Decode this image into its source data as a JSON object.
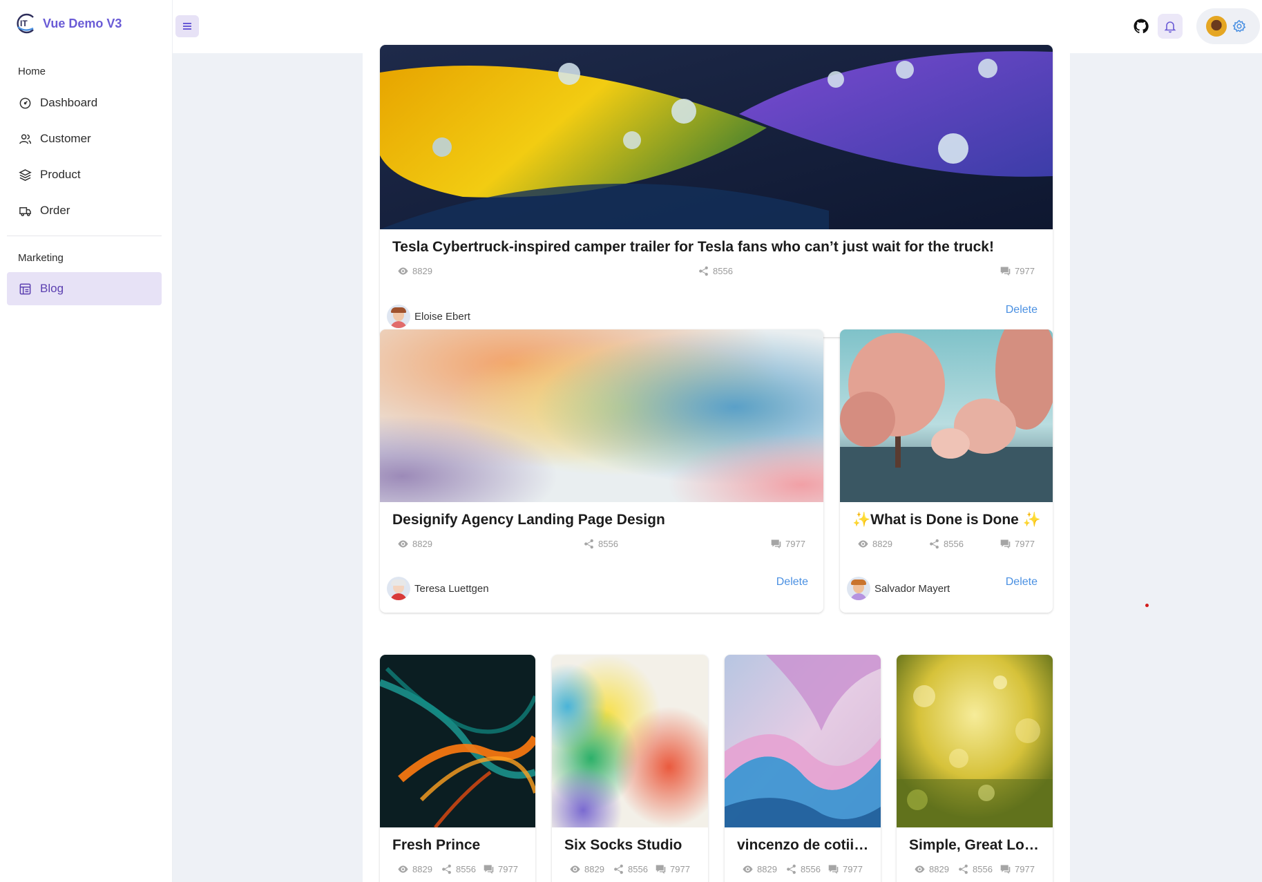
{
  "app": {
    "title": "Vue Demo V3",
    "accent": "#6a5bd6"
  },
  "sidebar": {
    "groups": [
      {
        "title": "Home",
        "items": [
          {
            "label": "Dashboard",
            "icon": "dashboard-gauge-icon"
          },
          {
            "label": "Customer",
            "icon": "users-icon"
          },
          {
            "label": "Product",
            "icon": "layers-icon"
          },
          {
            "label": "Order",
            "icon": "truck-icon"
          }
        ]
      },
      {
        "title": "Marketing",
        "items": [
          {
            "label": "Blog",
            "icon": "blog-layout-icon",
            "active": true
          }
        ]
      }
    ]
  },
  "header": {
    "menu_icon": "hamburger-menu-icon",
    "github_icon": "github-icon",
    "bell_icon": "bell-icon",
    "settings_icon": "gear-icon"
  },
  "posts": [
    {
      "title": "Tesla Cybertruck-inspired camper trailer for Tesla fans who can’t just wait for the truck!",
      "views": "8829",
      "shares": "8556",
      "comments": "7977",
      "author": "Eloise Ebert",
      "delete_label": "Delete",
      "image": "leaves with water drops, yellow and purple"
    },
    {
      "title": "Designify Agency Landing Page Design",
      "views": "8829",
      "shares": "8556",
      "comments": "7977",
      "author": "Teresa Luettgen",
      "delete_label": "Delete",
      "image": "pastel watercolor"
    },
    {
      "title": "✨What is Done is Done ✨",
      "views": "8829",
      "shares": "8556",
      "comments": "7977",
      "author": "Salvador Mayert",
      "delete_label": "Delete",
      "image": "pink trees in winter landscape"
    },
    {
      "title": "Fresh Prince",
      "views": "8829",
      "shares": "8556",
      "comments": "7977",
      "image": "orange and teal abstract smoke"
    },
    {
      "title": "Six Socks Studio",
      "views": "8829",
      "shares": "8556",
      "comments": "7977",
      "image": "rainbow watercolor splash"
    },
    {
      "title": "vincenzo de cotiis...",
      "views": "8829",
      "shares": "8556",
      "comments": "7977",
      "image": "pink and blue silk waves"
    },
    {
      "title": "Simple, Great Loo...",
      "views": "8829",
      "shares": "8556",
      "comments": "7977",
      "image": "yellow green bokeh"
    }
  ]
}
